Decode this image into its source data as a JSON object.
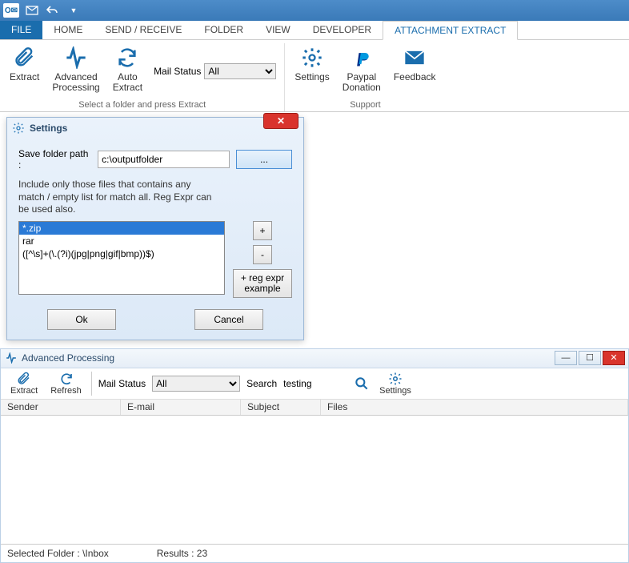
{
  "qat": {
    "undo_tip": "Undo"
  },
  "tabs": {
    "file": "FILE",
    "home": "HOME",
    "send_receive": "SEND / RECEIVE",
    "folder": "FOLDER",
    "view": "VIEW",
    "developer": "DEVELOPER",
    "attachment_extract": "ATTACHMENT EXTRACT"
  },
  "ribbon": {
    "extract": "Extract",
    "adv_proc": "Advanced\nProcessing",
    "auto_extract": "Auto\nExtract",
    "mail_status_label": "Mail Status",
    "mail_status_value": "All",
    "group1_label": "Select a folder and press Extract",
    "settings": "Settings",
    "paypal": "Paypal\nDonation",
    "feedback": "Feedback",
    "group2_label": "Support"
  },
  "settings_dialog": {
    "title": "Settings",
    "save_path_label": "Save folder path :",
    "save_path_value": "c:\\outputfolder",
    "browse": "...",
    "hint": "Include only those files that contains any match / empty list for match all. Reg Expr can be used also.",
    "items": [
      "*.zip",
      "rar",
      "([^\\s]+(\\.(?i)(jpg|png|gif|bmp))$)"
    ],
    "add": "+",
    "remove": "-",
    "reg_expr_example": "+ reg expr example",
    "ok": "Ok",
    "cancel": "Cancel"
  },
  "adv": {
    "title": "Advanced Processing",
    "extract": "Extract",
    "refresh": "Refresh",
    "mail_status_label": "Mail Status",
    "mail_status_value": "All",
    "search_label": "Search",
    "search_value": "testing",
    "settings": "Settings",
    "cols": {
      "sender": "Sender",
      "email": "E-mail",
      "subject": "Subject",
      "files": "Files"
    },
    "selected_folder_label": "Selected Folder :",
    "selected_folder_value": "\\Inbox",
    "results_label": "Results :",
    "results_value": "23"
  }
}
